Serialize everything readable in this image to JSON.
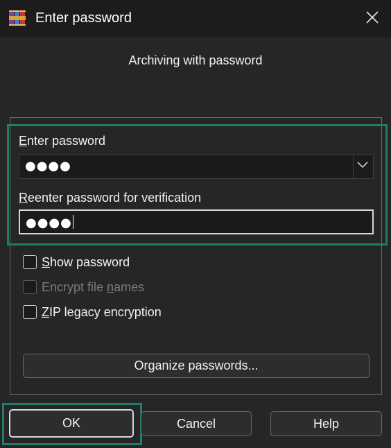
{
  "window": {
    "title": "Enter password",
    "close_icon": "close-icon",
    "app_icon": "winrar-books-icon"
  },
  "subtitle": "Archiving with password",
  "password": {
    "label_accel": "E",
    "label_rest": "nter password",
    "value_masked": "●●●●"
  },
  "reenter": {
    "label_accel": "R",
    "label_rest": "eenter password for verification",
    "value_masked": "●●●●"
  },
  "options": {
    "show_password": {
      "accel": "S",
      "rest": "how password",
      "checked": false,
      "enabled": true
    },
    "encrypt_names": {
      "pre": "Encrypt file ",
      "accel": "n",
      "rest": "ames",
      "checked": false,
      "enabled": false
    },
    "zip_legacy": {
      "accel": "Z",
      "rest": "IP legacy encryption",
      "checked": false,
      "enabled": true
    }
  },
  "buttons": {
    "organize": "Organize passwords...",
    "ok": "OK",
    "cancel": "Cancel",
    "help": "Help"
  },
  "colors": {
    "highlight": "#1f7d6a",
    "background": "#262626",
    "titlebar": "#1c1c1c"
  }
}
